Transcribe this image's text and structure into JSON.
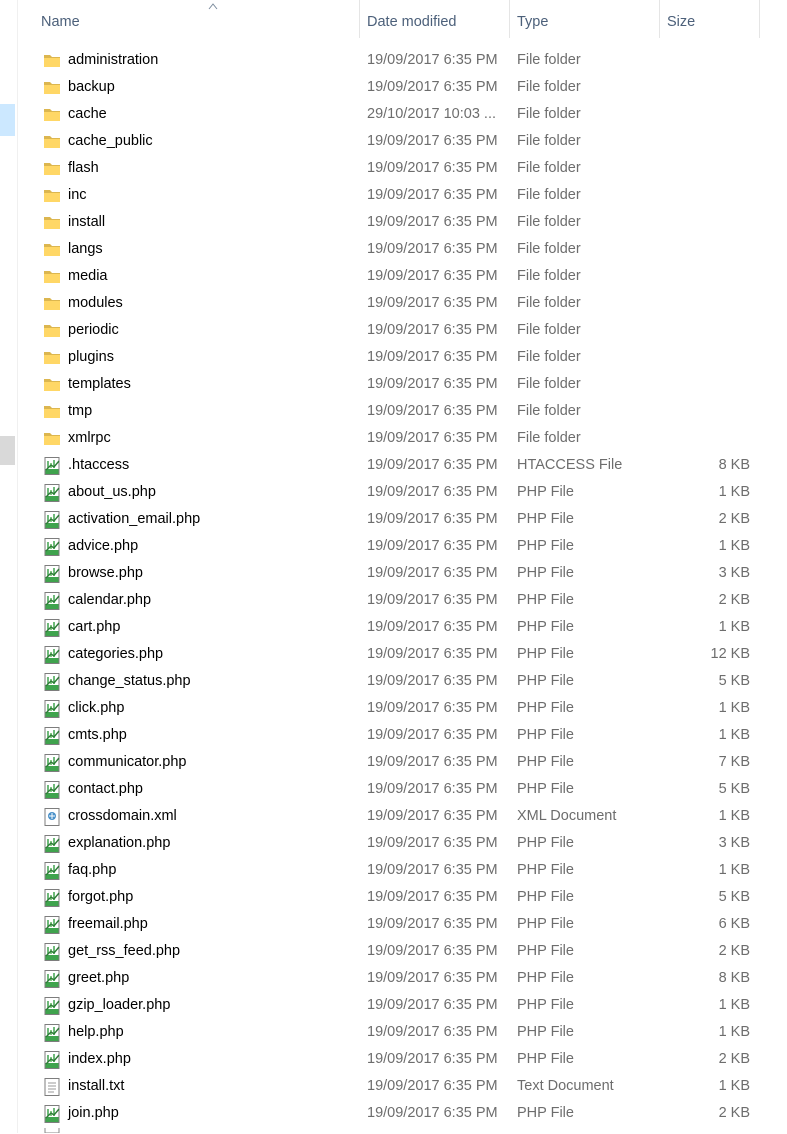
{
  "columns": {
    "name": "Name",
    "date": "Date modified",
    "type": "Type",
    "size": "Size"
  },
  "colors": {
    "header_text": "#4c607a",
    "muted_text": "#6d6d6d",
    "folder": "#ffd766",
    "php_green": "#3fa34d",
    "selection": "#cce8ff"
  },
  "files": [
    {
      "name": "administration",
      "date": "19/09/2017 6:35 PM",
      "type": "File folder",
      "size": "",
      "icon": "folder-icon"
    },
    {
      "name": "backup",
      "date": "19/09/2017 6:35 PM",
      "type": "File folder",
      "size": "",
      "icon": "folder-icon"
    },
    {
      "name": "cache",
      "date": "29/10/2017 10:03 ...",
      "type": "File folder",
      "size": "",
      "icon": "folder-icon"
    },
    {
      "name": "cache_public",
      "date": "19/09/2017 6:35 PM",
      "type": "File folder",
      "size": "",
      "icon": "folder-icon"
    },
    {
      "name": "flash",
      "date": "19/09/2017 6:35 PM",
      "type": "File folder",
      "size": "",
      "icon": "folder-icon"
    },
    {
      "name": "inc",
      "date": "19/09/2017 6:35 PM",
      "type": "File folder",
      "size": "",
      "icon": "folder-icon"
    },
    {
      "name": "install",
      "date": "19/09/2017 6:35 PM",
      "type": "File folder",
      "size": "",
      "icon": "folder-icon"
    },
    {
      "name": "langs",
      "date": "19/09/2017 6:35 PM",
      "type": "File folder",
      "size": "",
      "icon": "folder-icon"
    },
    {
      "name": "media",
      "date": "19/09/2017 6:35 PM",
      "type": "File folder",
      "size": "",
      "icon": "folder-icon"
    },
    {
      "name": "modules",
      "date": "19/09/2017 6:35 PM",
      "type": "File folder",
      "size": "",
      "icon": "folder-icon"
    },
    {
      "name": "periodic",
      "date": "19/09/2017 6:35 PM",
      "type": "File folder",
      "size": "",
      "icon": "folder-icon"
    },
    {
      "name": "plugins",
      "date": "19/09/2017 6:35 PM",
      "type": "File folder",
      "size": "",
      "icon": "folder-icon"
    },
    {
      "name": "templates",
      "date": "19/09/2017 6:35 PM",
      "type": "File folder",
      "size": "",
      "icon": "folder-icon"
    },
    {
      "name": "tmp",
      "date": "19/09/2017 6:35 PM",
      "type": "File folder",
      "size": "",
      "icon": "folder-icon"
    },
    {
      "name": "xmlrpc",
      "date": "19/09/2017 6:35 PM",
      "type": "File folder",
      "size": "",
      "icon": "folder-icon"
    },
    {
      "name": ".htaccess",
      "date": "19/09/2017 6:35 PM",
      "type": "HTACCESS File",
      "size": "8 KB",
      "icon": "code-file-icon"
    },
    {
      "name": "about_us.php",
      "date": "19/09/2017 6:35 PM",
      "type": "PHP File",
      "size": "1 KB",
      "icon": "code-file-icon"
    },
    {
      "name": "activation_email.php",
      "date": "19/09/2017 6:35 PM",
      "type": "PHP File",
      "size": "2 KB",
      "icon": "code-file-icon"
    },
    {
      "name": "advice.php",
      "date": "19/09/2017 6:35 PM",
      "type": "PHP File",
      "size": "1 KB",
      "icon": "code-file-icon"
    },
    {
      "name": "browse.php",
      "date": "19/09/2017 6:35 PM",
      "type": "PHP File",
      "size": "3 KB",
      "icon": "code-file-icon"
    },
    {
      "name": "calendar.php",
      "date": "19/09/2017 6:35 PM",
      "type": "PHP File",
      "size": "2 KB",
      "icon": "code-file-icon"
    },
    {
      "name": "cart.php",
      "date": "19/09/2017 6:35 PM",
      "type": "PHP File",
      "size": "1 KB",
      "icon": "code-file-icon"
    },
    {
      "name": "categories.php",
      "date": "19/09/2017 6:35 PM",
      "type": "PHP File",
      "size": "12 KB",
      "icon": "code-file-icon"
    },
    {
      "name": "change_status.php",
      "date": "19/09/2017 6:35 PM",
      "type": "PHP File",
      "size": "5 KB",
      "icon": "code-file-icon"
    },
    {
      "name": "click.php",
      "date": "19/09/2017 6:35 PM",
      "type": "PHP File",
      "size": "1 KB",
      "icon": "code-file-icon"
    },
    {
      "name": "cmts.php",
      "date": "19/09/2017 6:35 PM",
      "type": "PHP File",
      "size": "1 KB",
      "icon": "code-file-icon"
    },
    {
      "name": "communicator.php",
      "date": "19/09/2017 6:35 PM",
      "type": "PHP File",
      "size": "7 KB",
      "icon": "code-file-icon"
    },
    {
      "name": "contact.php",
      "date": "19/09/2017 6:35 PM",
      "type": "PHP File",
      "size": "5 KB",
      "icon": "code-file-icon"
    },
    {
      "name": "crossdomain.xml",
      "date": "19/09/2017 6:35 PM",
      "type": "XML Document",
      "size": "1 KB",
      "icon": "xml-file-icon"
    },
    {
      "name": "explanation.php",
      "date": "19/09/2017 6:35 PM",
      "type": "PHP File",
      "size": "3 KB",
      "icon": "code-file-icon"
    },
    {
      "name": "faq.php",
      "date": "19/09/2017 6:35 PM",
      "type": "PHP File",
      "size": "1 KB",
      "icon": "code-file-icon"
    },
    {
      "name": "forgot.php",
      "date": "19/09/2017 6:35 PM",
      "type": "PHP File",
      "size": "5 KB",
      "icon": "code-file-icon"
    },
    {
      "name": "freemail.php",
      "date": "19/09/2017 6:35 PM",
      "type": "PHP File",
      "size": "6 KB",
      "icon": "code-file-icon"
    },
    {
      "name": "get_rss_feed.php",
      "date": "19/09/2017 6:35 PM",
      "type": "PHP File",
      "size": "2 KB",
      "icon": "code-file-icon"
    },
    {
      "name": "greet.php",
      "date": "19/09/2017 6:35 PM",
      "type": "PHP File",
      "size": "8 KB",
      "icon": "code-file-icon"
    },
    {
      "name": "gzip_loader.php",
      "date": "19/09/2017 6:35 PM",
      "type": "PHP File",
      "size": "1 KB",
      "icon": "code-file-icon"
    },
    {
      "name": "help.php",
      "date": "19/09/2017 6:35 PM",
      "type": "PHP File",
      "size": "1 KB",
      "icon": "code-file-icon"
    },
    {
      "name": "index.php",
      "date": "19/09/2017 6:35 PM",
      "type": "PHP File",
      "size": "2 KB",
      "icon": "code-file-icon"
    },
    {
      "name": "install.txt",
      "date": "19/09/2017 6:35 PM",
      "type": "Text Document",
      "size": "1 KB",
      "icon": "text-file-icon"
    },
    {
      "name": "join.php",
      "date": "19/09/2017 6:35 PM",
      "type": "PHP File",
      "size": "2 KB",
      "icon": "code-file-icon"
    }
  ]
}
